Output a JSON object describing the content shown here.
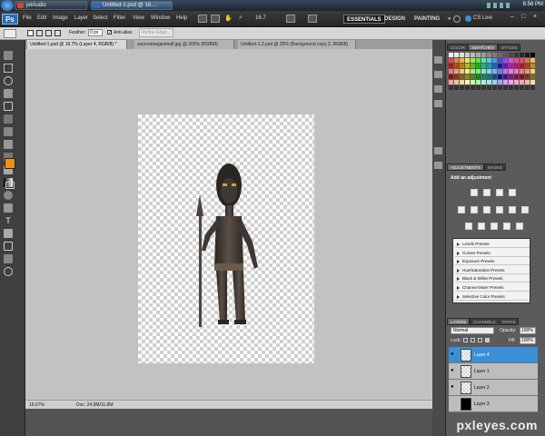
{
  "taskbar": {
    "start_label": "",
    "buttons": [
      {
        "label": "jetAudio",
        "color": "#d9442b"
      },
      {
        "label": "Untitled-1.psd @ 16....",
        "color": "#2b6bb0"
      }
    ],
    "clock": "6:56 PM"
  },
  "app": {
    "logo": "Ps",
    "menus": [
      "File",
      "Edit",
      "Image",
      "Layer",
      "Select",
      "Filter",
      "View",
      "Window",
      "Help"
    ],
    "zoom": "16.7",
    "workspaces": [
      "ESSENTIALS",
      "DESIGN",
      "PAINTING"
    ],
    "more": "»",
    "cs_live": "CS Live"
  },
  "options": {
    "feather_label": "Feather:",
    "feather_value": "0 px",
    "antialias_label": "Anti-alias",
    "refine_label": "Refine Edge..."
  },
  "tabs": [
    {
      "label": "Untitled-1.psd @ 16.7% (Layer 4, RGB/8) *"
    },
    {
      "label": "sourceimagesmall.jpg @ 200% (RGB/8)"
    },
    {
      "label": "Untitled-1.2.psd @ 25% (Background copy 2, RGB/8)"
    }
  ],
  "status": {
    "zoom": "16.67%",
    "doc": "Doc: 24.9M/11.8M"
  },
  "panels": {
    "swatch_tabs": [
      "COLOR",
      "SWATCHES",
      "STYLES"
    ],
    "adjust_tabs": [
      "ADJUSTMENTS",
      "MASKS"
    ],
    "adjust_header": "Add an adjustment",
    "presets": [
      "Levels Presets",
      "Curves Presets",
      "Exposure Presets",
      "Hue/Saturation Presets",
      "Black & White Presets",
      "Channel Mixer Presets",
      "Selective Color Presets"
    ],
    "layer_tabs": [
      "LAYERS",
      "CHANNELS",
      "PATHS"
    ],
    "blend_mode": "Normal",
    "opacity_label": "Opacity:",
    "opacity_value": "100%",
    "lock_label": "Lock:",
    "fill_label": "Fill:",
    "fill_value": "100%",
    "layers": [
      {
        "name": "Layer 4",
        "selected": true
      },
      {
        "name": "Layer 1",
        "selected": false
      },
      {
        "name": "Layer 2",
        "selected": false
      },
      {
        "name": "Layer 3",
        "selected": false
      }
    ]
  },
  "colors": {
    "foreground": "#f0900f",
    "background": "#ffffff",
    "selection": "#3a8fd6"
  },
  "watermark": "pxleyes.com"
}
